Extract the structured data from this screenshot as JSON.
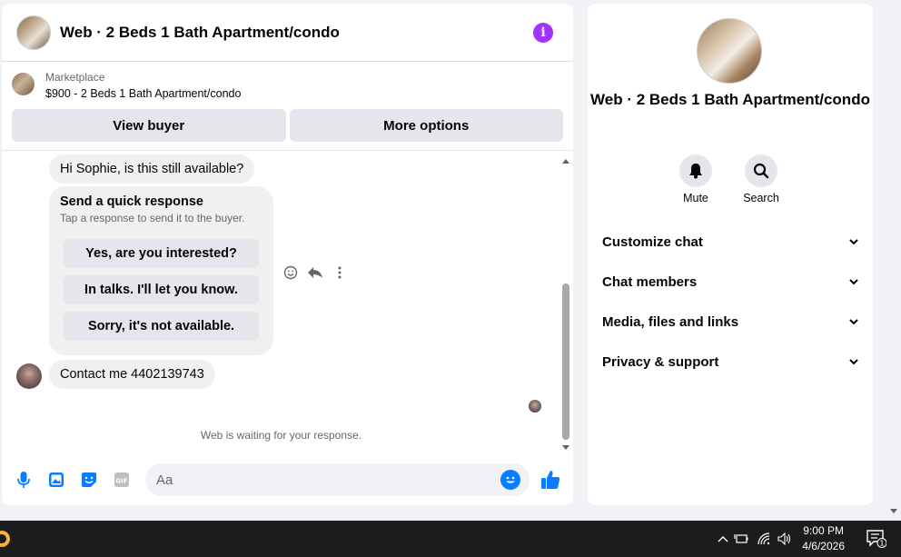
{
  "chat": {
    "title": "Web · 2 Beds 1 Bath Apartment/condo",
    "marketplace_label": "Marketplace",
    "listing": "$900 - 2 Beds 1 Bath Apartment/condo",
    "view_buyer": "View buyer",
    "more_options": "More options",
    "messages": {
      "first": "Hi Sophie, is this still available?",
      "quick_title": "Send a quick response",
      "quick_sub": "Tap a response to send it to the buyer.",
      "quick_options": [
        "Yes, are you interested?",
        "In talks. I'll let you know.",
        "Sorry, it's not available."
      ],
      "second": "Contact me 4402139743",
      "waiting": "Web is waiting for your response."
    },
    "composer_placeholder": "Aa"
  },
  "info": {
    "title": "Web · 2 Beds 1 Bath Apartment/condo",
    "mute_label": "Mute",
    "search_label": "Search",
    "sections": [
      "Customize chat",
      "Chat members",
      "Media, files and links",
      "Privacy & support"
    ]
  },
  "taskbar": {
    "time": "9:00 PM",
    "date": "4/6/2026",
    "notification_count": "1"
  },
  "colors": {
    "accent": "#0a7cff",
    "info": "#a033ff"
  },
  "icons": [
    "info-icon",
    "smile-icon",
    "reply-icon",
    "more-icon",
    "microphone-icon",
    "image-icon",
    "sticker-icon",
    "gif-icon",
    "emoji-icon",
    "thumbs-up-icon",
    "bell-icon",
    "search-icon",
    "chevron-down-icon"
  ]
}
